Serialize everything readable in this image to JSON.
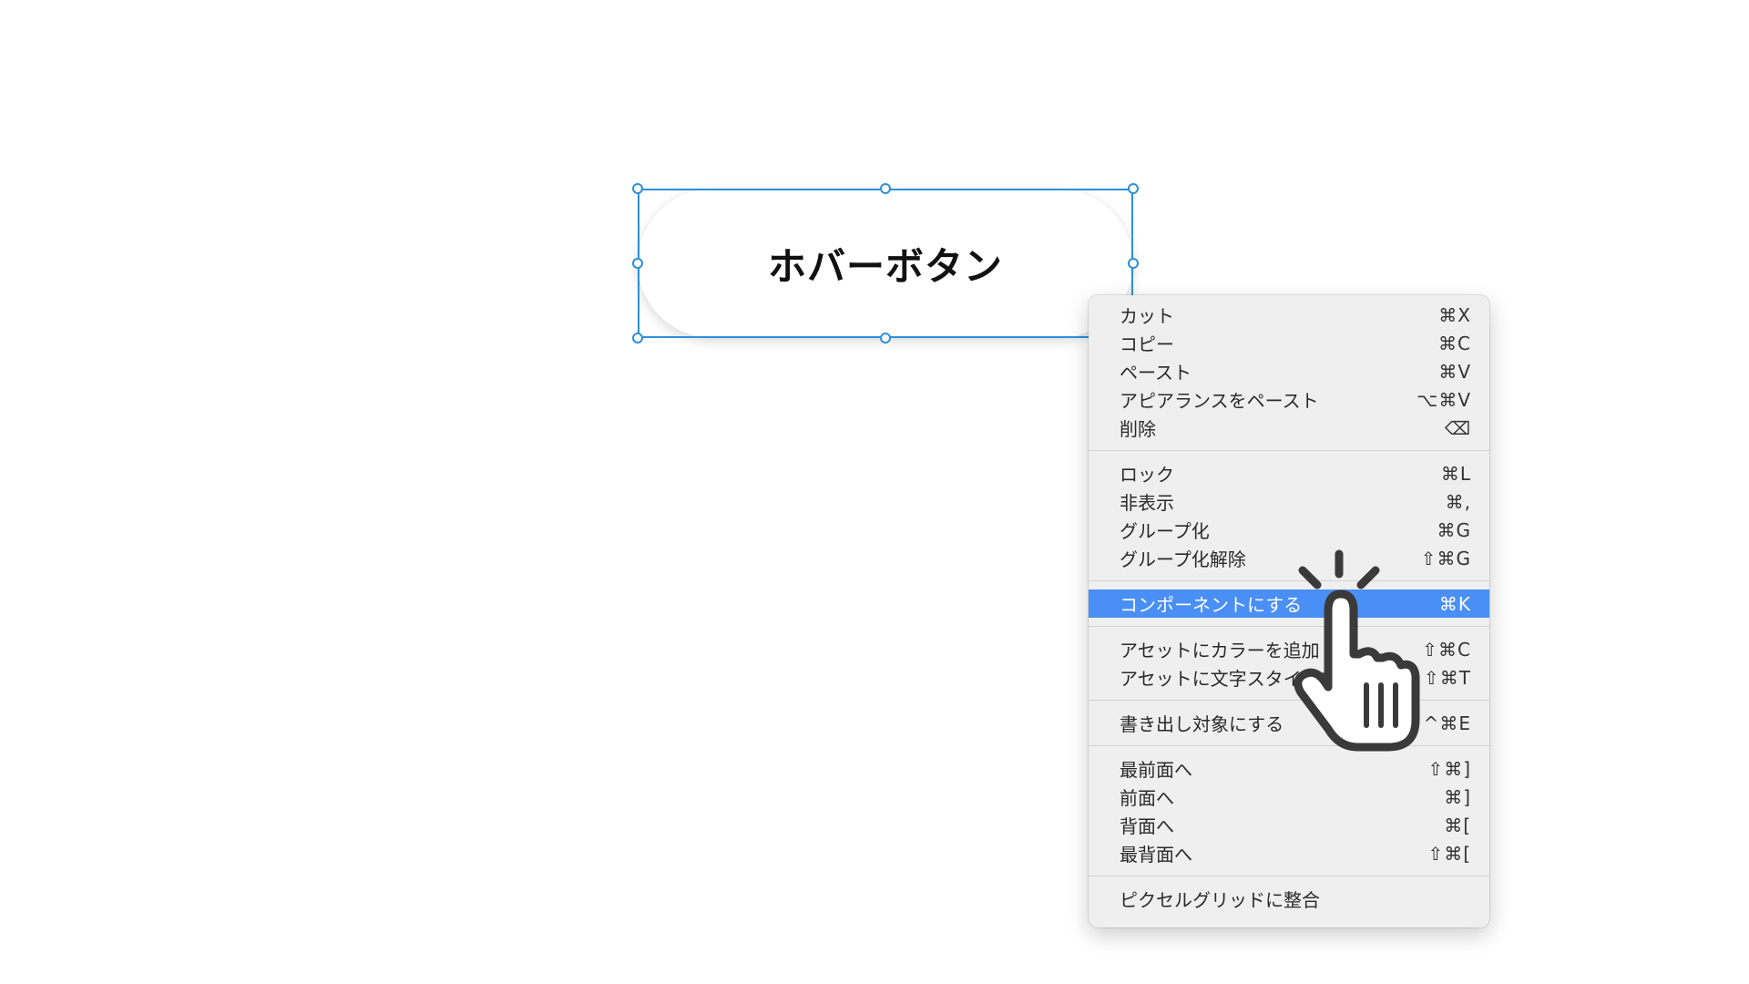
{
  "canvas": {
    "button_label": "ホバーボタン"
  },
  "context_menu": {
    "groups": [
      [
        {
          "label": "カット",
          "shortcut": "⌘X"
        },
        {
          "label": "コピー",
          "shortcut": "⌘C"
        },
        {
          "label": "ペースト",
          "shortcut": "⌘V"
        },
        {
          "label": "アピアランスをペースト",
          "shortcut": "⌥⌘V"
        },
        {
          "label": "削除",
          "shortcut": "⌫"
        }
      ],
      [
        {
          "label": "ロック",
          "shortcut": "⌘L"
        },
        {
          "label": "非表示",
          "shortcut": "⌘,"
        },
        {
          "label": "グループ化",
          "shortcut": "⌘G"
        },
        {
          "label": "グループ化解除",
          "shortcut": "⇧⌘G"
        }
      ],
      [
        {
          "label": "コンポーネントにする",
          "shortcut": "⌘K",
          "highlighted": true
        }
      ],
      [
        {
          "label": "アセットにカラーを追加",
          "shortcut": "⇧⌘C"
        },
        {
          "label": "アセットに文字スタイルを追加",
          "shortcut": "⇧⌘T"
        }
      ],
      [
        {
          "label": "書き出し対象にする",
          "shortcut": "^⌘E"
        }
      ],
      [
        {
          "label": "最前面へ",
          "shortcut": "⇧⌘]"
        },
        {
          "label": "前面へ",
          "shortcut": "⌘]"
        },
        {
          "label": "背面へ",
          "shortcut": "⌘["
        },
        {
          "label": "最背面へ",
          "shortcut": "⇧⌘["
        }
      ],
      [
        {
          "label": "ピクセルグリッドに整合",
          "shortcut": ""
        }
      ]
    ]
  },
  "cursor": {
    "icon": "pointing-hand-click-icon"
  },
  "colors": {
    "selection": "#2d8fdc",
    "menu_highlight": "#4a8ff5",
    "menu_background": "#efefef"
  }
}
